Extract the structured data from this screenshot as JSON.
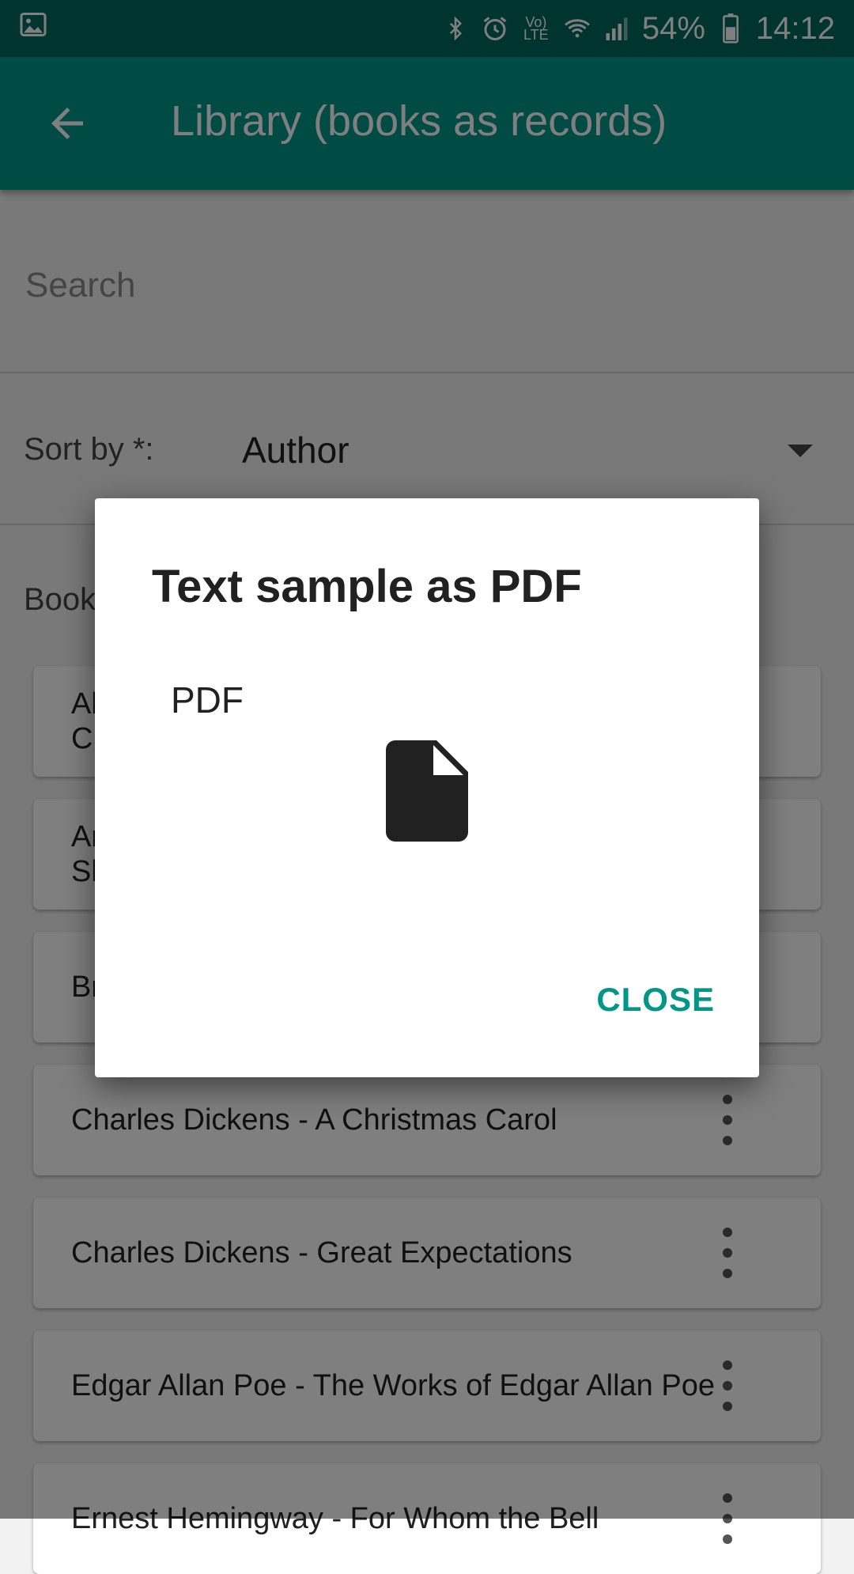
{
  "status_bar": {
    "battery": "54%",
    "time": "14:12",
    "lte_label": "Vo) LTE",
    "icons": [
      "image-icon",
      "bluetooth-icon",
      "alarm-icon",
      "volte-icon",
      "wifi-icon",
      "signal-icon",
      "battery-icon"
    ]
  },
  "app_bar": {
    "title": "Library (books as records)",
    "back_icon": "arrow-back-icon"
  },
  "search": {
    "placeholder": "Search",
    "value": ""
  },
  "sort": {
    "label": "Sort by *:",
    "value": "Author"
  },
  "books_label": "Book",
  "list": {
    "items": [
      {
        "text": "Al\nCr"
      },
      {
        "text": "Ar\nSh"
      },
      {
        "text": "Br"
      },
      {
        "text": "Charles Dickens - A Christmas Carol"
      },
      {
        "text": "Charles Dickens - Great Expectations"
      },
      {
        "text": "Edgar Allan Poe - The Works of Edgar Allan Poe"
      },
      {
        "text": "Ernest Hemingway - For Whom the Bell"
      }
    ]
  },
  "dialog": {
    "title": "Text sample as PDF",
    "field_label": "PDF",
    "file_icon": "file-icon",
    "close_label": "CLOSE"
  },
  "colors": {
    "primary": "#009688",
    "primary_dark": "#00695c",
    "accent_text": "#009688"
  }
}
